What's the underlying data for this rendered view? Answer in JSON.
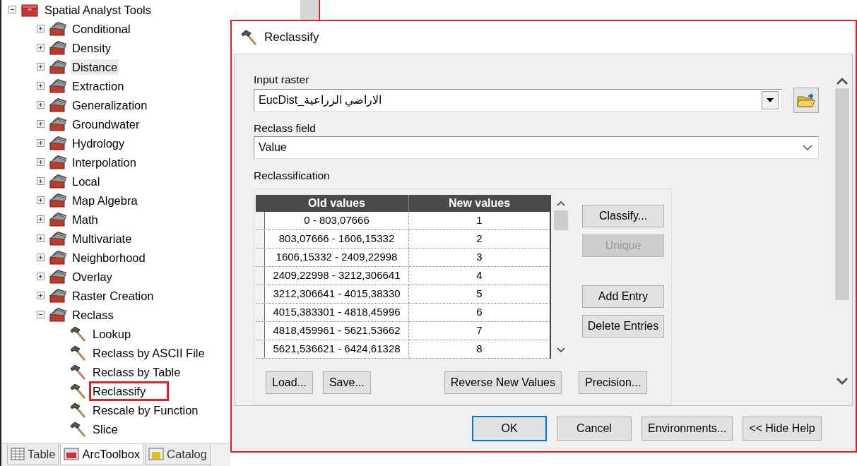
{
  "tree": {
    "label": "Spatial Analyst Tools",
    "expanded": true,
    "children": [
      {
        "label": "Conditional",
        "expanded": false,
        "highlighted": false
      },
      {
        "label": "Density",
        "expanded": false,
        "highlighted": false
      },
      {
        "label": "Distance",
        "expanded": false,
        "highlighted": true
      },
      {
        "label": "Extraction",
        "expanded": false,
        "highlighted": false
      },
      {
        "label": "Generalization",
        "expanded": false,
        "highlighted": false
      },
      {
        "label": "Groundwater",
        "expanded": false,
        "highlighted": false
      },
      {
        "label": "Hydrology",
        "expanded": false,
        "highlighted": false
      },
      {
        "label": "Interpolation",
        "expanded": false,
        "highlighted": false
      },
      {
        "label": "Local",
        "expanded": false,
        "highlighted": false
      },
      {
        "label": "Map Algebra",
        "expanded": false,
        "highlighted": false
      },
      {
        "label": "Math",
        "expanded": false,
        "highlighted": false
      },
      {
        "label": "Multivariate",
        "expanded": false,
        "highlighted": false
      },
      {
        "label": "Neighborhood",
        "expanded": false,
        "highlighted": false
      },
      {
        "label": "Overlay",
        "expanded": false,
        "highlighted": false
      },
      {
        "label": "Raster Creation",
        "expanded": false,
        "highlighted": false
      },
      {
        "label": "Reclass",
        "expanded": true,
        "highlighted": false,
        "children": [
          {
            "label": "Lookup",
            "annotated": false
          },
          {
            "label": "Reclass by ASCII File",
            "annotated": false
          },
          {
            "label": "Reclass by Table",
            "annotated": false
          },
          {
            "label": "Reclassify",
            "annotated": true
          },
          {
            "label": "Rescale by Function",
            "annotated": false
          },
          {
            "label": "Slice",
            "annotated": false
          }
        ]
      }
    ]
  },
  "bottom_tabs": [
    {
      "label": "Table",
      "selected": false,
      "kind": "table"
    },
    {
      "label": "ArcToolbox",
      "selected": true,
      "kind": "toolbox"
    },
    {
      "label": "Catalog",
      "selected": false,
      "kind": "catalog"
    }
  ],
  "dialog": {
    "title": "Reclassify",
    "input_raster": {
      "label": "Input raster",
      "value": "EucDist_الاراضي الزراعية"
    },
    "reclass_field": {
      "label": "Reclass field",
      "value": "Value"
    },
    "reclassification": {
      "label": "Reclassification",
      "columns": [
        "Old values",
        "New values"
      ],
      "rows": [
        {
          "old": "0 - 803,07666",
          "new": "1"
        },
        {
          "old": "803,07666 - 1606,15332",
          "new": "2"
        },
        {
          "old": "1606,15332 - 2409,22998",
          "new": "3"
        },
        {
          "old": "2409,22998 - 3212,306641",
          "new": "4"
        },
        {
          "old": "3212,306641 - 4015,38330",
          "new": "5"
        },
        {
          "old": "4015,383301 - 4818,45996",
          "new": "6"
        },
        {
          "old": "4818,459961 - 5621,53662",
          "new": "7"
        },
        {
          "old": "5621,536621 - 6424,61328",
          "new": "8"
        }
      ],
      "side_buttons": [
        {
          "label": "Classify...",
          "disabled": false
        },
        {
          "label": "Unique",
          "disabled": true
        },
        {
          "label": "Add Entry",
          "disabled": false
        },
        {
          "label": "Delete Entries",
          "disabled": false
        }
      ],
      "bottom_buttons": [
        {
          "label": "Load..."
        },
        {
          "label": "Save..."
        },
        {
          "label": "Reverse New Values"
        },
        {
          "label": "Precision..."
        }
      ]
    },
    "footer_buttons": [
      {
        "label": "OK",
        "default": true
      },
      {
        "label": "Cancel",
        "default": false
      },
      {
        "label": "Environments...",
        "default": false
      },
      {
        "label": "<< Hide Help",
        "default": false
      }
    ]
  }
}
